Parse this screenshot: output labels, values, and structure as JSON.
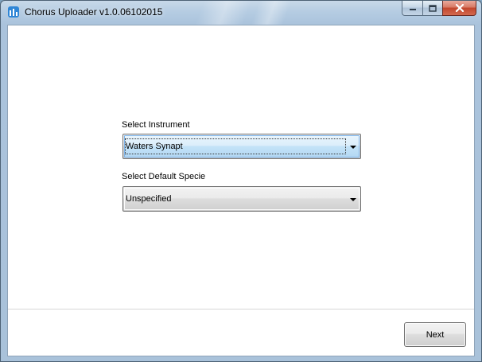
{
  "window": {
    "title": "Chorus Uploader v1.0.06102015"
  },
  "icons": {
    "app": "chorus-app-icon",
    "minimize": "minimize-icon",
    "maximize": "maximize-icon",
    "close": "close-icon"
  },
  "form": {
    "instrument": {
      "label": "Select Instrument",
      "value": "Waters Synapt"
    },
    "specie": {
      "label": "Select Default Specie",
      "value": "Unspecified"
    }
  },
  "footer": {
    "next_label": "Next"
  }
}
